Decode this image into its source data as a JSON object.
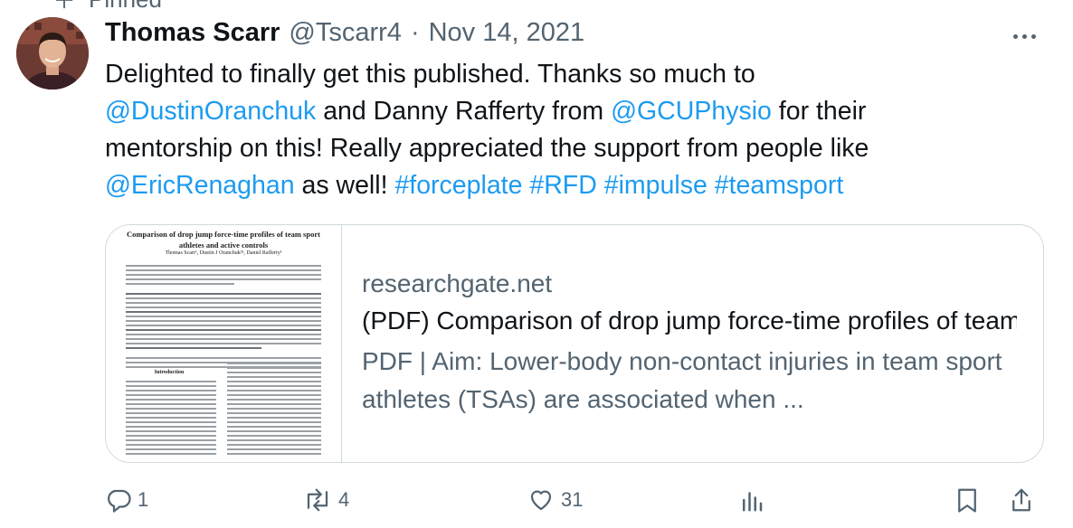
{
  "pinned_label": "Pinned",
  "author": {
    "name": "Thomas Scarr",
    "handle": "@Tscarr4",
    "separator": "·",
    "date": "Nov 14, 2021"
  },
  "tweet": {
    "line1_text": "Delighted to finally get this published. Thanks so much to",
    "mention1": "@DustinOranchuk",
    "line2_mid": " and Danny Rafferty from ",
    "mention2": "@GCUPhysio",
    "line2_end": " for their",
    "line3_text": "mentorship on this! Really appreciated the support from people like",
    "mention3": "@EricRenaghan",
    "line4_mid": " as well! ",
    "hashtags": [
      "#forceplate",
      "#RFD",
      "#impulse",
      "#teamsport"
    ]
  },
  "card": {
    "domain": "researchgate.net",
    "title": "(PDF) Comparison of drop jump force-time profiles of team sport athletes and active controls",
    "description": "PDF | Aim: Lower-body non-contact injuries in team sport athletes (TSAs) are associated when ...",
    "thumbnail": {
      "paper_title": "Comparison of drop jump force-time profiles of team sport athletes and active controls",
      "paper_authors": "Thomas Scarr¹, Dustin J Oranchuk²³, Daniel Rafferty¹",
      "section_heading": "Introduction"
    }
  },
  "actions": {
    "replies": "1",
    "reposts": "4",
    "likes": "31"
  },
  "colors": {
    "link": "#1d9bf0",
    "secondary_text": "#536471",
    "border": "#cfd9de"
  },
  "icons": [
    "pin-icon",
    "more-icon",
    "reply-icon",
    "repost-icon",
    "like-icon",
    "views-icon",
    "bookmark-icon",
    "share-icon"
  ]
}
